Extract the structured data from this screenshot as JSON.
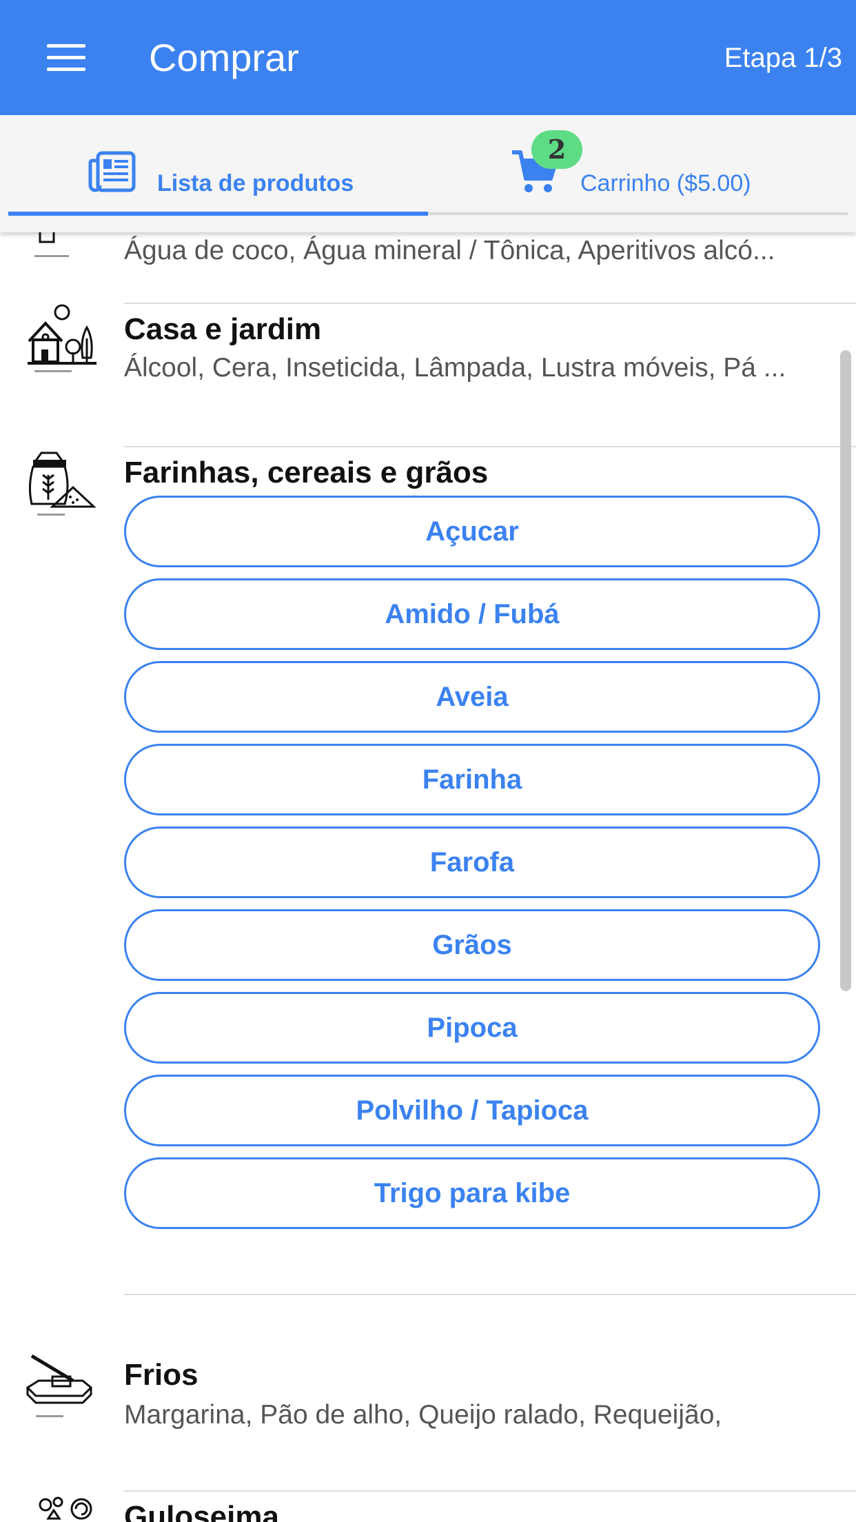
{
  "header": {
    "title": "Comprar",
    "step": "Etapa 1/3"
  },
  "tabs": {
    "products_label": "Lista de produtos",
    "cart_label": "Carrinho ($5.00)",
    "cart_count": "2"
  },
  "categories": {
    "bebidas": {
      "items": "Água de coco, Água mineral / Tônica, Aperitivos alcó..."
    },
    "casa": {
      "title": "Casa e jardim",
      "items": "Álcool, Cera, Inseticida, Lâmpada, Lustra móveis, Pá ..."
    },
    "farinhas": {
      "title": "Farinhas, cereais e grãos",
      "options": [
        "Açucar",
        "Amido / Fubá",
        "Aveia",
        "Farinha",
        "Farofa",
        "Grãos",
        "Pipoca",
        "Polvilho / Tapioca",
        "Trigo para kibe"
      ]
    },
    "frios": {
      "title": "Frios",
      "items": "Margarina, Pão de alho, Queijo ralado, Requeijão,"
    },
    "guloseima": {
      "title": "Guloseima"
    }
  },
  "colors": {
    "primary": "#3b82f0",
    "badge": "#5edb85"
  }
}
